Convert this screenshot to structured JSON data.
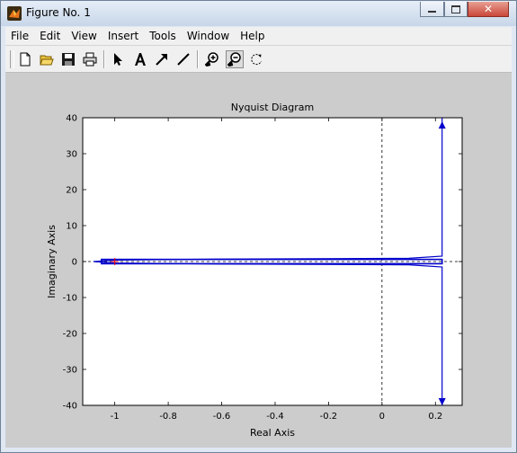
{
  "window": {
    "title": "Figure No. 1"
  },
  "menu": [
    "File",
    "Edit",
    "View",
    "Insert",
    "Tools",
    "Window",
    "Help"
  ],
  "toolbar": {
    "buttons": [
      "new-document",
      "open-folder",
      "save",
      "print",
      "select-arrow",
      "insert-text",
      "insert-arrow",
      "insert-line",
      "zoom-in",
      "zoom-out",
      "rotate-3d"
    ],
    "pressed": "zoom-out"
  },
  "chart_data": {
    "type": "line",
    "title": "Nyquist Diagram",
    "xlabel": "Real Axis",
    "ylabel": "Imaginary Axis",
    "xlim": [
      -1.12,
      0.3
    ],
    "ylim": [
      -40,
      40
    ],
    "xticks": [
      "-1",
      "-0.8",
      "-0.6",
      "-0.4",
      "-0.2",
      "0",
      "0.2"
    ],
    "xtick_values": [
      -1,
      -0.8,
      -0.6,
      -0.4,
      -0.2,
      0,
      0.2
    ],
    "yticks": [
      "40",
      "30",
      "20",
      "10",
      "0",
      "-10",
      "-20",
      "-30",
      "-40"
    ],
    "ytick_values": [
      40,
      30,
      20,
      10,
      0,
      -10,
      -20,
      -30,
      -40
    ],
    "series": [
      {
        "color": "#0000cc",
        "points": [
          [
            0.225,
            -40
          ],
          [
            0.225,
            -1.5
          ],
          [
            0.1,
            -0.9
          ],
          [
            -0.6,
            -0.7
          ],
          [
            -1.0,
            -0.4
          ],
          [
            -1.08,
            0
          ],
          [
            -1.0,
            0.4
          ],
          [
            -0.6,
            0.7
          ],
          [
            0.1,
            0.9
          ],
          [
            0.225,
            1.5
          ],
          [
            0.225,
            40
          ]
        ]
      }
    ],
    "arrows": [
      [
        0.225,
        38
      ],
      [
        0.225,
        -39
      ]
    ],
    "critical_point": [
      -1,
      0
    ],
    "critical_point_color": "#ff0000",
    "zero_lines": "dashed"
  }
}
